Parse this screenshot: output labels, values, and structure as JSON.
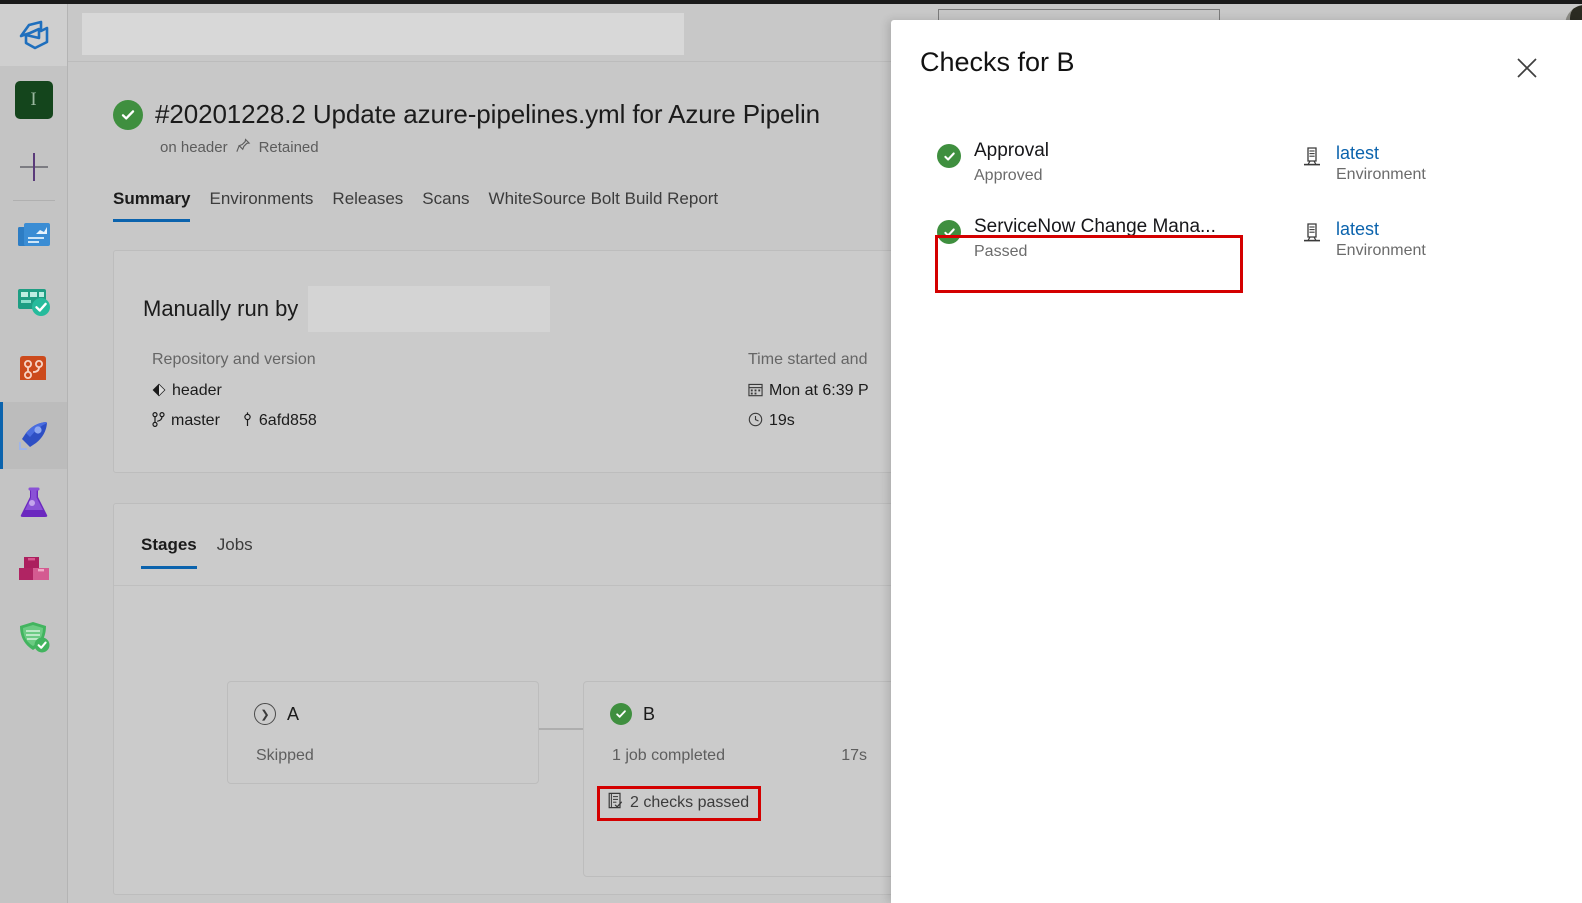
{
  "app": {
    "name": "Azure DevOps",
    "logo_icon": "azure-devops-logo-icon",
    "accent_color": "#0b63ad",
    "success_color": "#3f8f3f",
    "highlight_color": "#d40000"
  },
  "rail": {
    "org_initial": "I",
    "items": [
      {
        "name": "new-item",
        "icon": "plus-icon",
        "label": ""
      },
      {
        "name": "overview",
        "icon": "overview-dashboard-icon",
        "label": ""
      },
      {
        "name": "boards",
        "icon": "boards-icon",
        "label": ""
      },
      {
        "name": "repos",
        "icon": "repos-branch-icon",
        "label": ""
      },
      {
        "name": "pipelines",
        "icon": "pipelines-rocket-icon",
        "label": "",
        "selected": true
      },
      {
        "name": "test-plans",
        "icon": "test-plans-flask-icon",
        "label": ""
      },
      {
        "name": "artifacts",
        "icon": "artifacts-boxes-icon",
        "label": ""
      },
      {
        "name": "security",
        "icon": "security-shield-check-icon",
        "label": ""
      }
    ]
  },
  "topbar": {
    "breadcrumb_redacted": true,
    "search_placeholder": "",
    "search_value": "",
    "avatar_icon": "user-avatar"
  },
  "run": {
    "status_icon": "check-circle-icon",
    "title": "#20201228.2 Update azure-pipelines.yml for Azure Pipelin",
    "subtitle_branch": "on header",
    "pin_icon": "pin-icon",
    "retained_label": "Retained"
  },
  "nav_tabs": [
    {
      "label": "Summary",
      "active": true
    },
    {
      "label": "Environments",
      "active": false
    },
    {
      "label": "Releases",
      "active": false
    },
    {
      "label": "Scans",
      "active": false
    },
    {
      "label": "WhiteSource Bolt Build Report",
      "active": false
    }
  ],
  "info_card": {
    "run_by_label": "Manually run by",
    "run_by_user_redacted": true,
    "repo_heading": "Repository and version",
    "repo_icon": "repository-icon",
    "repo_name": "header",
    "branch_icon": "branch-icon",
    "branch_name": "master",
    "commit_icon": "commit-icon",
    "commit_sha": "6afd858",
    "time_heading": "Time started and",
    "calendar_icon": "calendar-icon",
    "time_started": "Mon at 6:39 P",
    "duration_icon": "clock-icon",
    "duration": "19s"
  },
  "stages_card": {
    "tabs": [
      {
        "label": "Stages",
        "active": true
      },
      {
        "label": "Jobs",
        "active": false
      }
    ],
    "stages": [
      {
        "name": "A",
        "status_icon": "skipped-chevron-circle-icon",
        "status_text": "Skipped",
        "duration": "",
        "checks_label": ""
      },
      {
        "name": "B",
        "status_icon": "check-circle-icon",
        "status_text": "1 job completed",
        "duration": "17s",
        "checks_icon": "checklist-icon",
        "checks_label": "2 checks passed",
        "checks_highlighted": true
      }
    ]
  },
  "checks_panel": {
    "title": "Checks for B",
    "close_icon": "close-icon",
    "checks": [
      {
        "status_icon": "check-circle-icon",
        "name": "Approval",
        "state": "Approved",
        "resource_icon": "environment-server-icon",
        "resource_link": "latest",
        "resource_type": "Environment",
        "highlighted": false
      },
      {
        "status_icon": "check-circle-icon",
        "name": "ServiceNow Change Mana...",
        "state": "Passed",
        "resource_icon": "environment-server-icon",
        "resource_link": "latest",
        "resource_type": "Environment",
        "highlighted": true
      }
    ]
  }
}
